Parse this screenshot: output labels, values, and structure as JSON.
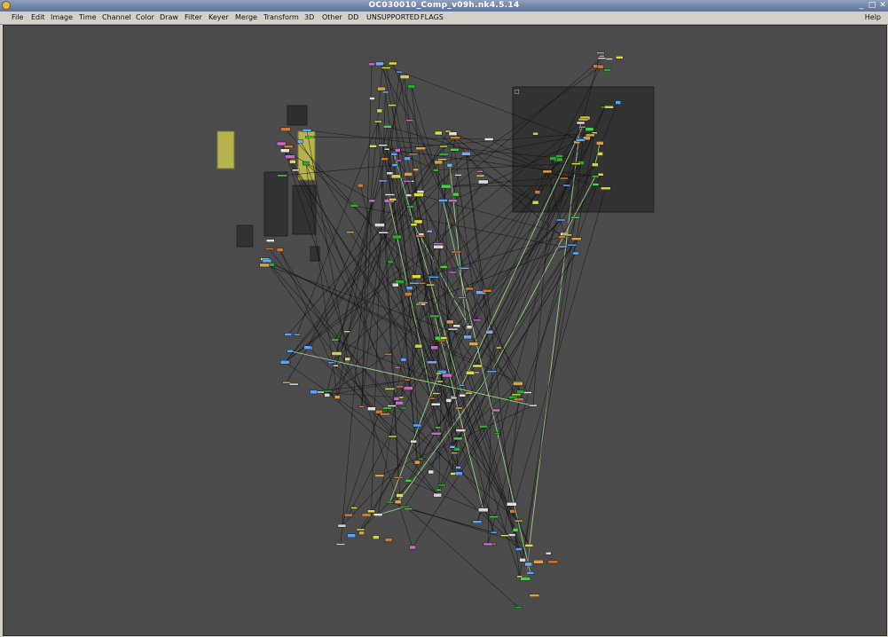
{
  "window": {
    "title": "OC030010_Comp_v09h.nk4.5.14",
    "app_icon": "nuke-app-icon"
  },
  "window_controls": {
    "minimize": "_",
    "maximize": "□",
    "close": "✕"
  },
  "menu": {
    "items": [
      "File",
      "Edit",
      "Image",
      "Time",
      "Channel",
      "Color",
      "Draw",
      "Filter",
      "Keyer",
      "Merge",
      "Transform",
      "3D",
      "Other",
      "DD",
      "UNSUPPORTED",
      "FLAGS"
    ],
    "help": "Help"
  },
  "canvas": {
    "background": "#4b4b4b",
    "wire_color": "#111111",
    "highlight_wire_color": "#9fdc8a",
    "node_colors": [
      "#7fa6e6",
      "#5aa2ff",
      "#46d246",
      "#2ea82e",
      "#d2a24c",
      "#cfcf57",
      "#c26cc2",
      "#d6d6d6",
      "#e0e0e0",
      "#dcdc3a",
      "#c87a3a"
    ],
    "group_labels": [
      "□"
    ]
  }
}
